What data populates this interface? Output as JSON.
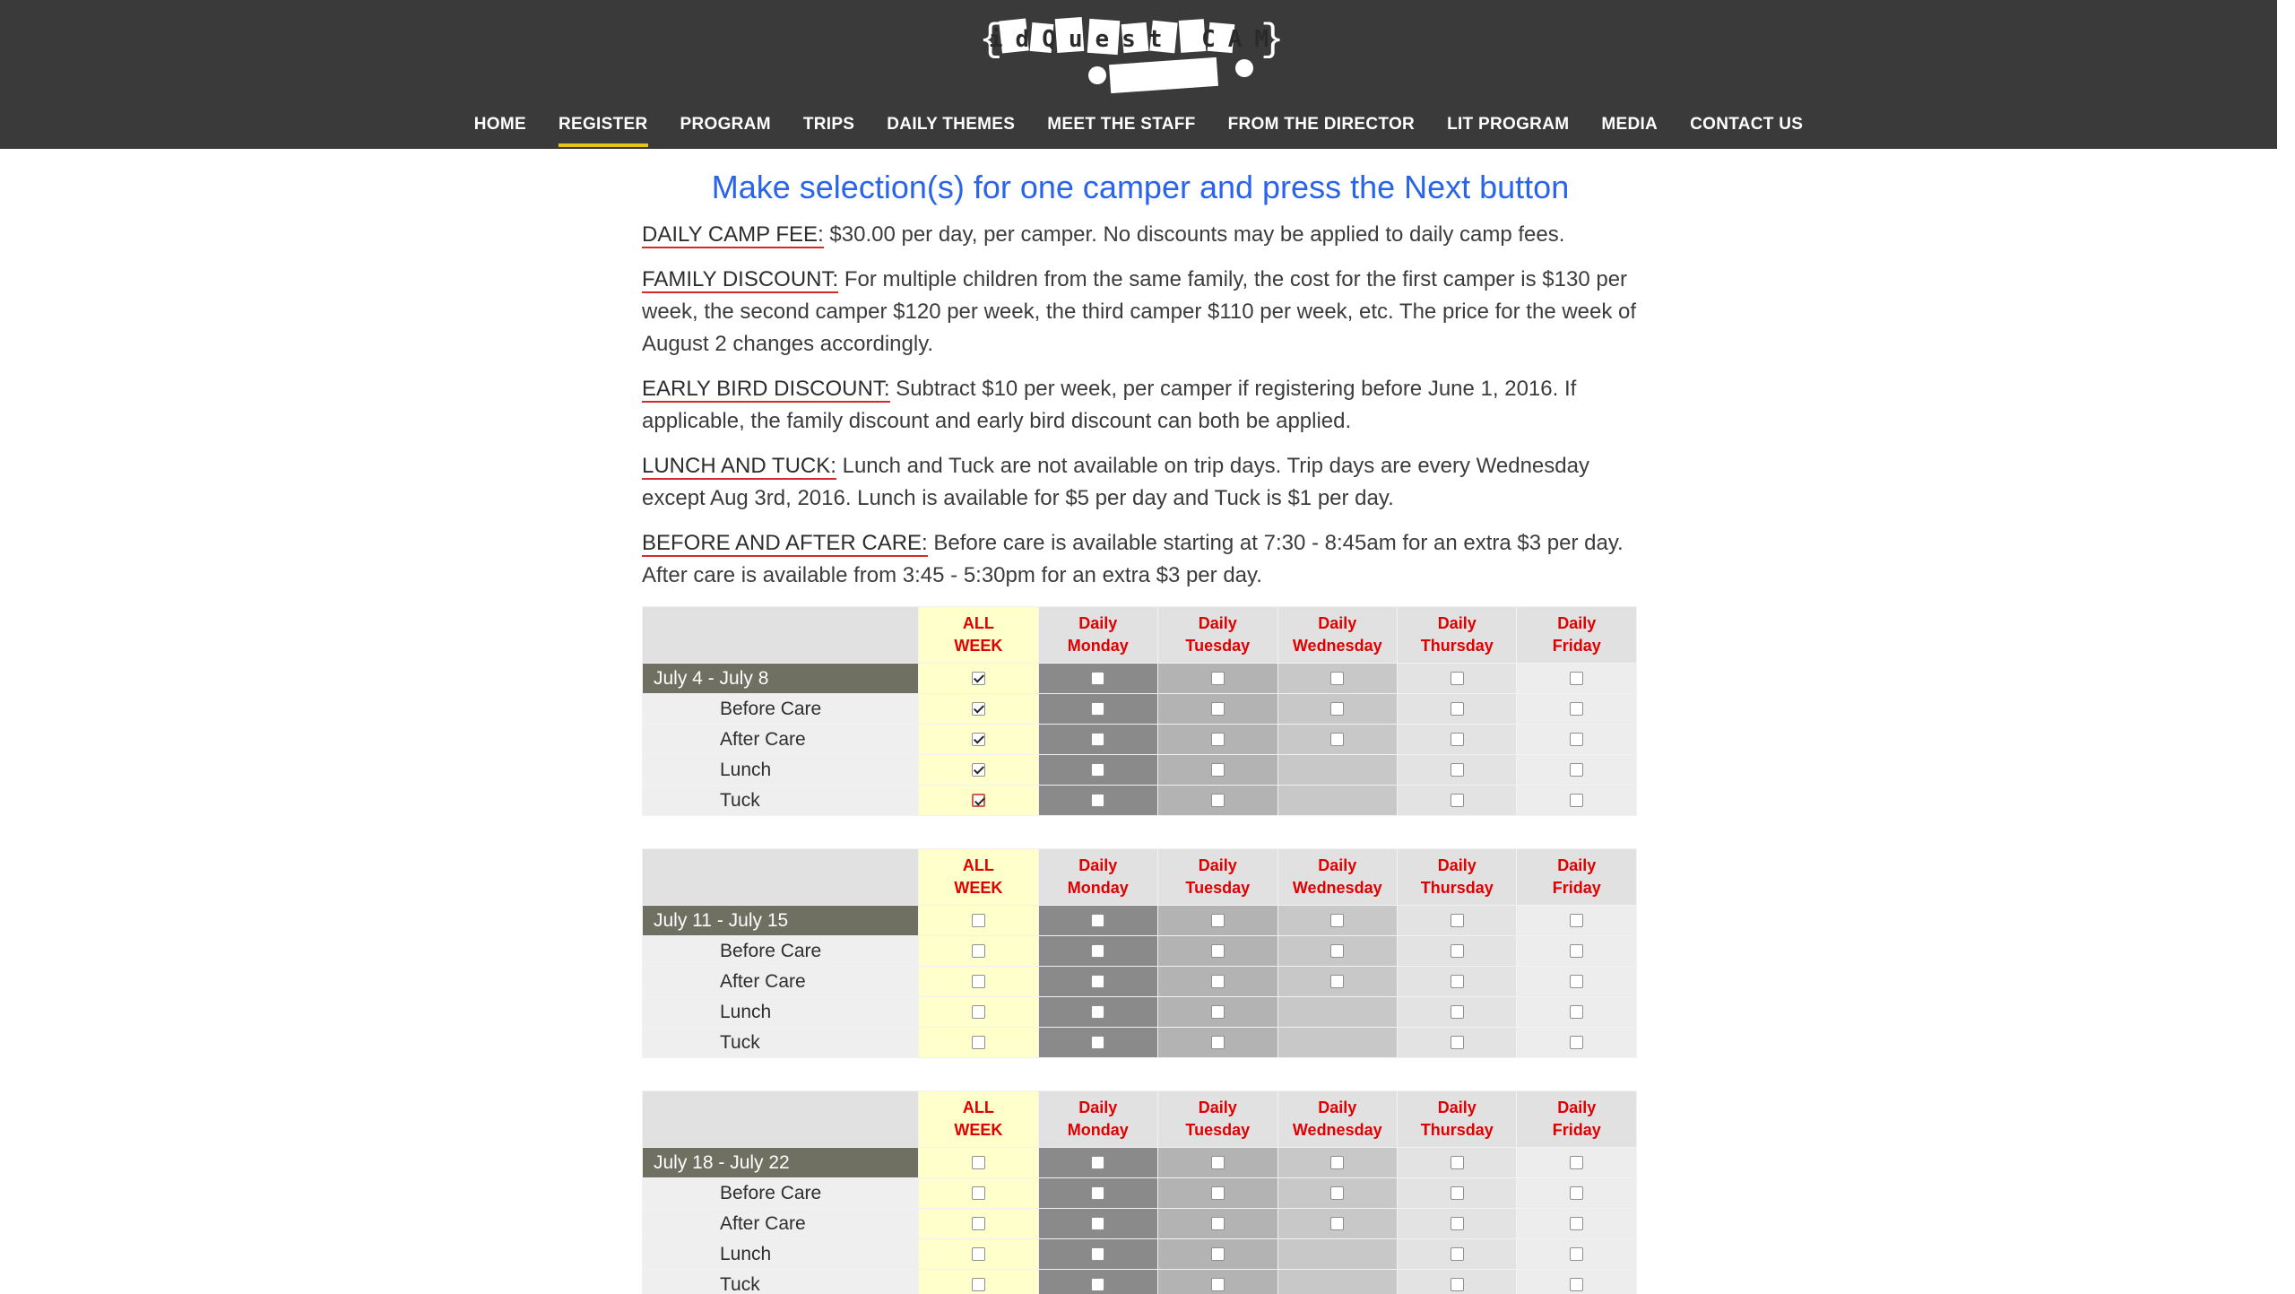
{
  "header": {
    "logo_text": "KidQuest CAMP",
    "nav": [
      {
        "label": "HOME",
        "active": false
      },
      {
        "label": "REGISTER",
        "active": true
      },
      {
        "label": "PROGRAM",
        "active": false
      },
      {
        "label": "TRIPS",
        "active": false
      },
      {
        "label": "DAILY THEMES",
        "active": false
      },
      {
        "label": "MEET THE STAFF",
        "active": false
      },
      {
        "label": "FROM THE DIRECTOR",
        "active": false
      },
      {
        "label": "LIT PROGRAM",
        "active": false
      },
      {
        "label": "MEDIA",
        "active": false
      },
      {
        "label": "CONTACT US",
        "active": false
      }
    ]
  },
  "main": {
    "title": "Make selection(s) for one camper and press the Next button",
    "paragraphs": [
      {
        "label": "DAILY CAMP FEE:",
        "text": " $30.00 per day, per camper. No discounts may be applied to daily camp fees."
      },
      {
        "label": "FAMILY DISCOUNT:",
        "text": " For multiple children from the same family, the cost for the first camper is $130 per week, the second camper $120 per week, the third camper $110 per week, etc. The price for the week of August 2 changes accordingly."
      },
      {
        "label": "EARLY BIRD DISCOUNT:",
        "text": " Subtract $10 per week, per camper if registering before June 1, 2016. If applicable, the family discount and early bird discount can both be applied."
      },
      {
        "label": "LUNCH AND TUCK:",
        "text": " Lunch and Tuck are not available on trip days. Trip days are every Wednesday except Aug 3rd, 2016. Lunch is available for $5 per day and Tuck is $1 per day."
      },
      {
        "label": "BEFORE AND AFTER CARE:",
        "text": " Before care is available starting at 7:30 - 8:45am for an extra $3 per day. After care is available from 3:45 - 5:30pm for an extra $3 per day."
      }
    ]
  },
  "schedule": {
    "columns": [
      {
        "line1": "ALL",
        "line2": "WEEK"
      },
      {
        "line1": "Daily",
        "line2": "Monday"
      },
      {
        "line1": "Daily",
        "line2": "Tuesday"
      },
      {
        "line1": "Daily",
        "line2": "Wednesday"
      },
      {
        "line1": "Daily",
        "line2": "Thursday"
      },
      {
        "line1": "Daily",
        "line2": "Friday"
      }
    ],
    "row_labels": [
      "Before Care",
      "After Care",
      "Lunch",
      "Tuck"
    ],
    "weeks": [
      {
        "label": "July 4 - July 8",
        "rows": [
          [
            true,
            false,
            false,
            false,
            false,
            false
          ],
          [
            true,
            false,
            false,
            false,
            false,
            false
          ],
          [
            true,
            false,
            false,
            false,
            false,
            false
          ],
          [
            true,
            false,
            false,
            null,
            false,
            false
          ],
          [
            true,
            false,
            false,
            null,
            false,
            false
          ]
        ]
      },
      {
        "label": "July 11 - July 15",
        "rows": [
          [
            false,
            false,
            false,
            false,
            false,
            false
          ],
          [
            false,
            false,
            false,
            false,
            false,
            false
          ],
          [
            false,
            false,
            false,
            false,
            false,
            false
          ],
          [
            false,
            false,
            false,
            null,
            false,
            false
          ],
          [
            false,
            false,
            false,
            null,
            false,
            false
          ]
        ]
      },
      {
        "label": "July 18 - July 22",
        "rows": [
          [
            false,
            false,
            false,
            false,
            false,
            false
          ],
          [
            false,
            false,
            false,
            false,
            false,
            false
          ],
          [
            false,
            false,
            false,
            false,
            false,
            false
          ],
          [
            false,
            false,
            false,
            null,
            false,
            false
          ],
          [
            false,
            false,
            false,
            null,
            false,
            false
          ]
        ]
      }
    ]
  },
  "colors": {
    "header_bg": "#3a3a3a",
    "nav_active_underline": "#e4c51c",
    "title": "#2a64e8",
    "label_underline": "#d32a2a",
    "column_header_text": "#e00000",
    "all_week_bg": "#ffffcc",
    "week_label_bg": "#6f6f62"
  }
}
